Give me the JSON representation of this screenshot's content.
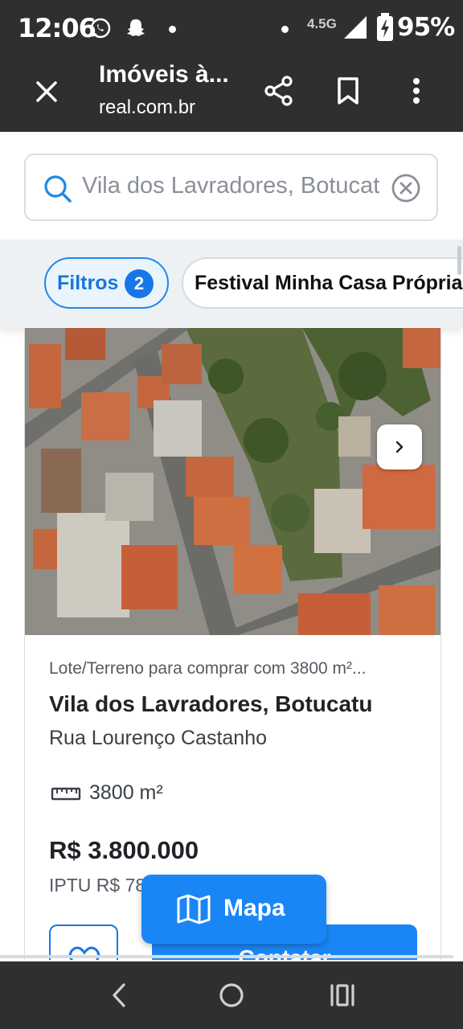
{
  "status_bar": {
    "time": "12:06",
    "network": "4.5G",
    "battery": "95%"
  },
  "browser_toolbar": {
    "title": "Imóveis à...",
    "url": "real.com.br",
    "icons": [
      "close-icon",
      "share-icon",
      "bookmark-icon",
      "more-vert-icon"
    ]
  },
  "search": {
    "value": "Vila dos Lavradores, Botucatu"
  },
  "filters": {
    "filters_label": "Filtros",
    "filters_count": "2",
    "promo_label": "Festival Minha Casa Própria"
  },
  "listing": {
    "type_line": "Lote/Terreno para comprar com 3800 m²...",
    "neighborhood": "Vila dos Lavradores, Botucatu",
    "street": "Rua Lourenço Castanho",
    "area": "3800 m²",
    "price": "R$ 3.800.000",
    "iptu": "IPTU R$ 78",
    "contact_label": "Contatar"
  },
  "map_button": {
    "label": "Mapa"
  },
  "colors": {
    "accent": "#1a86f5",
    "dark_bar": "#2e2f31"
  }
}
